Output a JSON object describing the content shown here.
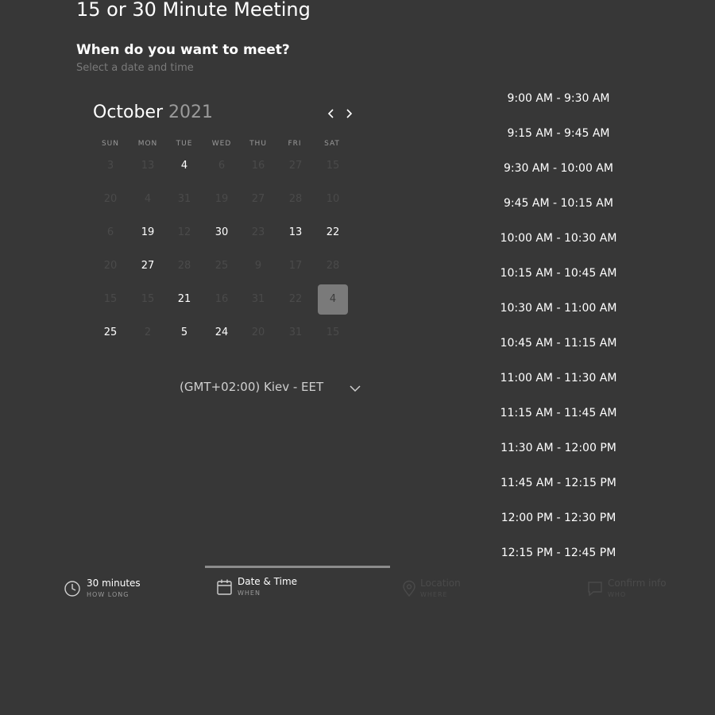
{
  "header": {
    "title": "15 or 30 Minute Meeting",
    "question": "When do you want to meet?",
    "subtitle": "Select a date and time"
  },
  "calendar": {
    "month": "October",
    "year": "2021",
    "prev_icon": "chevron-left-icon",
    "next_icon": "chevron-right-icon",
    "weekdays": [
      "SUN",
      "MON",
      "TUE",
      "WED",
      "THU",
      "FRI",
      "SAT"
    ],
    "weeks": [
      [
        {
          "d": "3",
          "a": false
        },
        {
          "d": "13",
          "a": false
        },
        {
          "d": "4",
          "a": true
        },
        {
          "d": "6",
          "a": false
        },
        {
          "d": "16",
          "a": false
        },
        {
          "d": "27",
          "a": false
        },
        {
          "d": "15",
          "a": false
        }
      ],
      [
        {
          "d": "20",
          "a": false
        },
        {
          "d": "4",
          "a": false
        },
        {
          "d": "31",
          "a": false
        },
        {
          "d": "19",
          "a": false
        },
        {
          "d": "27",
          "a": false
        },
        {
          "d": "28",
          "a": false
        },
        {
          "d": "10",
          "a": false
        }
      ],
      [
        {
          "d": "6",
          "a": false
        },
        {
          "d": "19",
          "a": true
        },
        {
          "d": "12",
          "a": false
        },
        {
          "d": "30",
          "a": true
        },
        {
          "d": "23",
          "a": false
        },
        {
          "d": "13",
          "a": true
        },
        {
          "d": "22",
          "a": true
        }
      ],
      [
        {
          "d": "20",
          "a": false
        },
        {
          "d": "27",
          "a": true
        },
        {
          "d": "28",
          "a": false
        },
        {
          "d": "25",
          "a": false
        },
        {
          "d": "9",
          "a": false
        },
        {
          "d": "17",
          "a": false
        },
        {
          "d": "28",
          "a": false
        }
      ],
      [
        {
          "d": "15",
          "a": false
        },
        {
          "d": "15",
          "a": false
        },
        {
          "d": "21",
          "a": true
        },
        {
          "d": "16",
          "a": false
        },
        {
          "d": "31",
          "a": false
        },
        {
          "d": "22",
          "a": false
        },
        {
          "d": "4",
          "a": true,
          "sel": true
        }
      ],
      [
        {
          "d": "25",
          "a": true
        },
        {
          "d": "2",
          "a": false
        },
        {
          "d": "5",
          "a": true
        },
        {
          "d": "24",
          "a": true
        },
        {
          "d": "20",
          "a": false
        },
        {
          "d": "31",
          "a": false
        },
        {
          "d": "15",
          "a": false
        }
      ]
    ],
    "timezone": "(GMT+02:00) Kiev - EET",
    "timezone_icon": "chevron-down-icon"
  },
  "time_slots": [
    "9:00 AM - 9:30 AM",
    "9:15 AM - 9:45 AM",
    "9:30 AM - 10:00 AM",
    "9:45 AM - 10:15 AM",
    "10:00 AM - 10:30 AM",
    "10:15 AM - 10:45 AM",
    "10:30 AM - 11:00 AM",
    "10:45 AM - 11:15 AM",
    "11:00 AM - 11:30 AM",
    "11:15 AM - 11:45 AM",
    "11:30 AM - 12:00 PM",
    "11:45 AM - 12:15 PM",
    "12:00 PM - 12:30 PM",
    "12:15 PM - 12:45 PM"
  ],
  "steps": [
    {
      "label": "30 minutes",
      "sub": "HOW LONG",
      "icon": "clock-icon"
    },
    {
      "label": "Date & Time",
      "sub": "WHEN",
      "icon": "calendar-icon"
    },
    {
      "label": "Location",
      "sub": "WHERE",
      "icon": "location-pin-icon"
    },
    {
      "label": "Confirm info",
      "sub": "WHO",
      "icon": "chat-icon"
    }
  ]
}
